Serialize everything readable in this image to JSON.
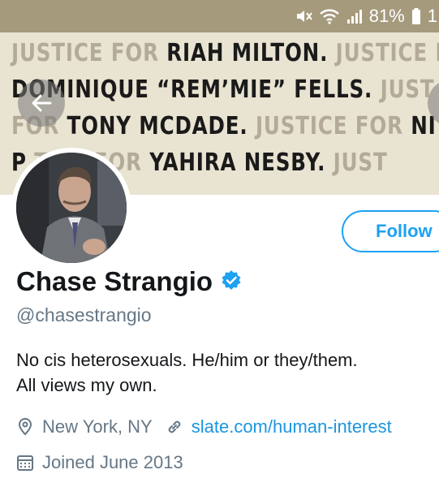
{
  "status_bar": {
    "battery_percent": "81%",
    "time_partial": "1",
    "icons": [
      "mute-icon",
      "wifi-icon",
      "signal-icon",
      "battery-icon"
    ]
  },
  "banner": {
    "lines": [
      [
        {
          "t": "JUSTICE FOR ",
          "c": "gr"
        },
        {
          "t": "RIAH MILTON.",
          "c": "bk"
        },
        {
          "t": " JUSTICE F",
          "c": "gr"
        }
      ],
      [
        {
          "t": "DOMINIQUE “REM’MIE” FELLS.",
          "c": "bk"
        },
        {
          "t": " JUST",
          "c": "gr"
        }
      ],
      [
        {
          "t": "FOR ",
          "c": "gr"
        },
        {
          "t": "TONY MCDADE.",
          "c": "bk"
        },
        {
          "t": " JUSTICE FOR ",
          "c": "gr"
        },
        {
          "t": "NI",
          "c": "bk"
        }
      ],
      [
        {
          "t": "P",
          "c": "bk"
        },
        {
          "t": "                       ",
          "c": "gr"
        },
        {
          "t": "TICE FOR ",
          "c": "gr"
        },
        {
          "t": "YAHIRA NESBY.",
          "c": "bk"
        },
        {
          "t": " JUST",
          "c": "gr"
        }
      ]
    ]
  },
  "profile": {
    "name": "Chase Strangio",
    "handle": "@chasestrangio",
    "bio_line1": "No cis heterosexuals. He/him or they/them.",
    "bio_line2": "All views my own.",
    "location": "New York, NY",
    "website": "slate.com/human-interest",
    "joined": "Joined June 2013",
    "follow_label": "Follow"
  },
  "colors": {
    "accent": "#1da1f2",
    "link": "#1b95e0",
    "secondary_text": "#657786",
    "status_bar": "#a69a7d",
    "banner_bg": "#e9e3d2"
  }
}
